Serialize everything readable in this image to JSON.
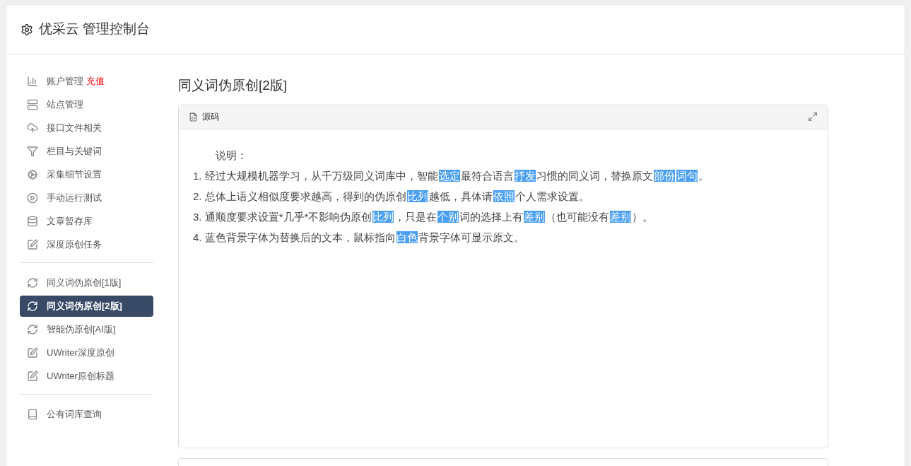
{
  "header": {
    "title": "优采云 管理控制台"
  },
  "sidebar": {
    "groups": [
      [
        {
          "label": "账户管理",
          "badge": "充值",
          "selected": false
        },
        {
          "label": "站点管理",
          "selected": false
        },
        {
          "label": "接口文件相关",
          "selected": false
        },
        {
          "label": "栏目与关键词",
          "selected": false
        },
        {
          "label": "采集细节设置",
          "selected": false
        },
        {
          "label": "手动运行测试",
          "selected": false
        },
        {
          "label": "文章暂存库",
          "selected": false
        },
        {
          "label": "深度原创任务",
          "selected": false
        }
      ],
      [
        {
          "label": "同义词伪原创[1版]",
          "selected": false
        },
        {
          "label": "同义词伪原创[2版]",
          "selected": true
        },
        {
          "label": "智能伪原创[AI版]",
          "selected": false
        },
        {
          "label": "UWriter深度原创",
          "selected": false
        },
        {
          "label": "UWriter原创标题",
          "selected": false
        }
      ],
      [
        {
          "label": "公有词库查询",
          "selected": false
        }
      ]
    ]
  },
  "page_title": "同义词伪原创[2版]",
  "panel": {
    "title": "源码",
    "heading": "说明：",
    "lines": [
      [
        {
          "text": "1. 经过大规模机器学习，从千万级同义词库中，智能",
          "highlighted": false
        },
        {
          "text": "选定",
          "highlighted": true
        },
        {
          "text": "最符合语言",
          "highlighted": false
        },
        {
          "text": "抒发",
          "highlighted": true
        },
        {
          "text": "习惯的同义词，替换原文",
          "highlighted": false
        },
        {
          "text": "部份",
          "highlighted": true
        },
        {
          "text": "词句",
          "highlighted": true
        },
        {
          "text": "。",
          "highlighted": false
        }
      ],
      [
        {
          "text": "2. 总体上语义相似度要求越高，得到的伪原创",
          "highlighted": false
        },
        {
          "text": "比列",
          "highlighted": true
        },
        {
          "text": "越低，具体请",
          "highlighted": false
        },
        {
          "text": "依照",
          "highlighted": true
        },
        {
          "text": "个人需求设置。",
          "highlighted": false
        }
      ],
      [
        {
          "text": "3. 通顺度要求设置*几乎*不影响伪原创",
          "highlighted": false
        },
        {
          "text": "比列",
          "highlighted": true
        },
        {
          "text": "，只是在",
          "highlighted": false
        },
        {
          "text": "个别",
          "highlighted": true
        },
        {
          "text": "词的选择上有",
          "highlighted": false
        },
        {
          "text": "差别",
          "highlighted": true
        },
        {
          "text": "（也可能没有",
          "highlighted": false
        },
        {
          "text": "差别",
          "highlighted": true
        },
        {
          "text": "）。",
          "highlighted": false
        }
      ],
      [
        {
          "text": "4. 蓝色背景字体为替换后的文本，鼠标指向",
          "highlighted": false
        },
        {
          "text": "白色",
          "highlighted": true
        },
        {
          "text": "背景字体可显示原文。",
          "highlighted": false
        }
      ]
    ]
  }
}
